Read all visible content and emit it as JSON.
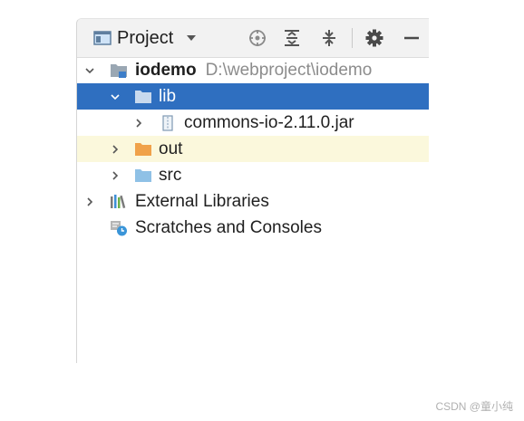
{
  "toolbar": {
    "title": "Project",
    "icons": [
      "locate-icon",
      "expand-all-icon",
      "collapse-all-icon",
      "gear-icon",
      "minimize-icon"
    ]
  },
  "tree": {
    "root": {
      "name": "iodemo",
      "path": "D:\\webproject\\iodemo"
    },
    "lib": "lib",
    "jar": "commons-io-2.11.0.jar",
    "out": "out",
    "src": "src",
    "external": "External Libraries",
    "scratches": "Scratches and Consoles"
  },
  "watermark": "CSDN @童小纯",
  "colors": {
    "selection": "#2f6fc0",
    "highlight_row": "#fbf8dc",
    "folder_blue": "#8fc1e6",
    "folder_orange": "#f0a24a"
  }
}
